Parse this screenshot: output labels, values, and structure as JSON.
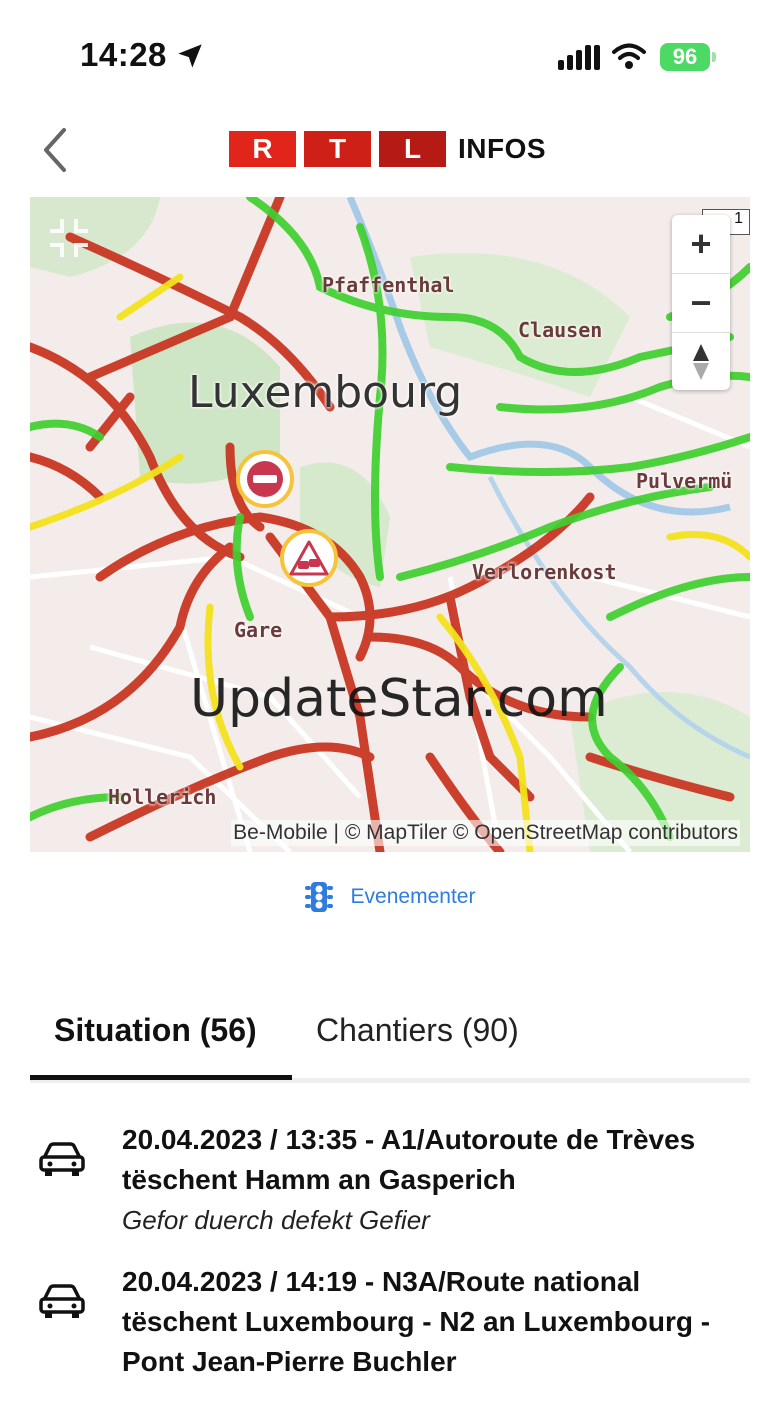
{
  "status_bar": {
    "time": "14:28",
    "battery": "96"
  },
  "header": {
    "logo_letters": [
      "R",
      "T",
      "L"
    ],
    "logo_suffix": "INFOS"
  },
  "map": {
    "city_label": "Luxembourg",
    "places": [
      "Pfaffenthal",
      "Clausen",
      "Pulvermü",
      "Verlorenkost",
      "Gare",
      "Hollerich"
    ],
    "watermark": "UpdateStar.com",
    "attribution": "Be-Mobile | © MapTiler © OpenStreetMap contributors",
    "scale_text": "1",
    "zoom_in": "+",
    "zoom_out": "−"
  },
  "events_link": {
    "label": "Evenementer"
  },
  "tabs": [
    {
      "label": "Situation (56)",
      "active": true
    },
    {
      "label": "Chantiers (90)",
      "active": false
    }
  ],
  "incidents": [
    {
      "title": "20.04.2023 / 13:35 - A1/Autoroute de Trèves tëschent Hamm an Gasperich",
      "subtitle": "Gefor duerch defekt Gefier"
    },
    {
      "title": "20.04.2023 / 14:19 - N3A/Route national tëschent Luxembourg - N2 an Luxembourg - Pont Jean-Pierre Buchler",
      "subtitle": ""
    }
  ],
  "colors": {
    "brand_red": "#e1251b",
    "link_blue": "#2f7be0",
    "traffic_green": "#3fcf2f",
    "traffic_red": "#c8321e",
    "traffic_yellow": "#f2e21b"
  }
}
